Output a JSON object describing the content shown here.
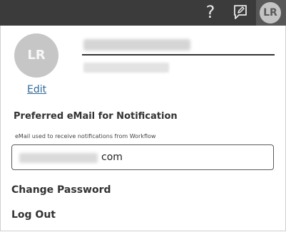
{
  "topbar": {
    "help_icon": "help-question-icon",
    "help_glyph": "?",
    "feedback_icon": "feedback-pencil-icon",
    "avatar_initials": "LR"
  },
  "profile": {
    "avatar_initials": "LR",
    "edit_label": "Edit"
  },
  "notification": {
    "title": "Preferred eMail for Notification",
    "description": "eMail used to receive notifications from Workflow",
    "email_visible_suffix": "com"
  },
  "menu": {
    "change_password": "Change Password",
    "log_out": "Log Out"
  }
}
